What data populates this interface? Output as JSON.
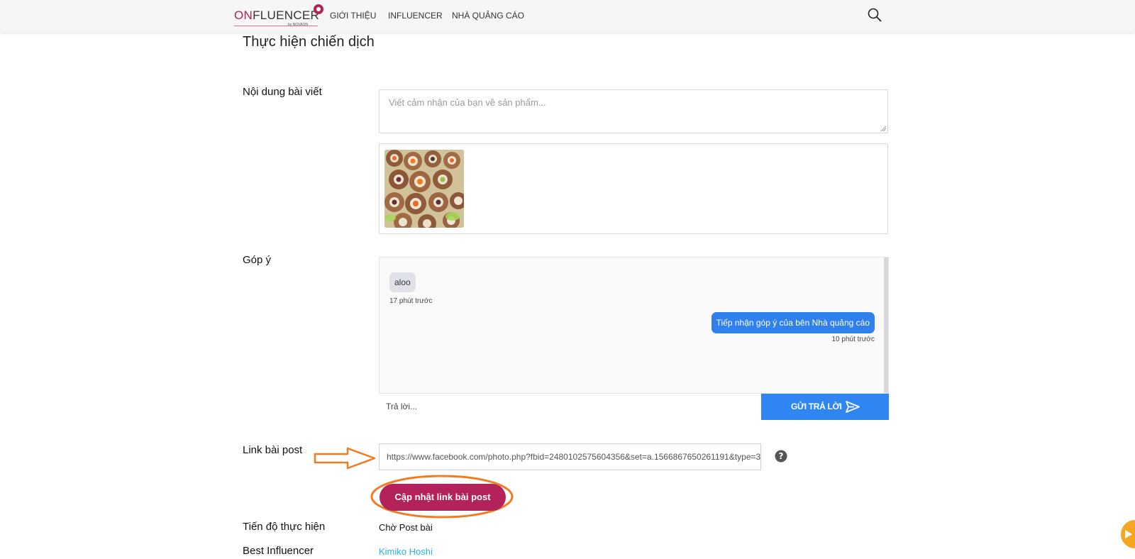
{
  "header": {
    "logo": {
      "on": "ON",
      "rest": "FLUENCER",
      "by": "by NOVAON"
    },
    "nav": [
      "GIỚI THIỆU",
      "INFLUENCER",
      "NHÀ QUẢNG CÁO"
    ],
    "search_icon": "search-icon"
  },
  "page_title": "Thực hiện chiến dịch",
  "content": {
    "label": "Nội dung bài viết",
    "placeholder": "Viết cảm nhận của bạn về sản phẩm...",
    "image_icon": "sushi-photo"
  },
  "feedback": {
    "label": "Góp ý",
    "messages": [
      {
        "side": "left",
        "text": "aloo",
        "time": "17 phút trước"
      },
      {
        "side": "right",
        "text": "Tiếp nhận góp ý của bên Nhà quảng cáo",
        "time": "10 phút trước"
      }
    ],
    "reply_placeholder": "Trả lời...",
    "send_label": "GỬI TRẢ LỜI",
    "send_icon": "send-icon"
  },
  "post_link": {
    "label": "Link bài post",
    "value": "https://www.facebook.com/photo.php?fbid=2480102575604356&set=a.1566867650261191&type=3",
    "help_icon": "question-circle-icon",
    "update_label": "Cập nhật link bài post"
  },
  "progress": {
    "label": "Tiến độ thực hiện",
    "value": "Chờ Post bài"
  },
  "best": {
    "label": "Best Influencer",
    "value": "Kimiko Hoshi"
  },
  "colors": {
    "brand": "#b3225a",
    "primary_blue": "#2f86f2",
    "annotation": "#f07d24",
    "link": "#27b4d9"
  }
}
